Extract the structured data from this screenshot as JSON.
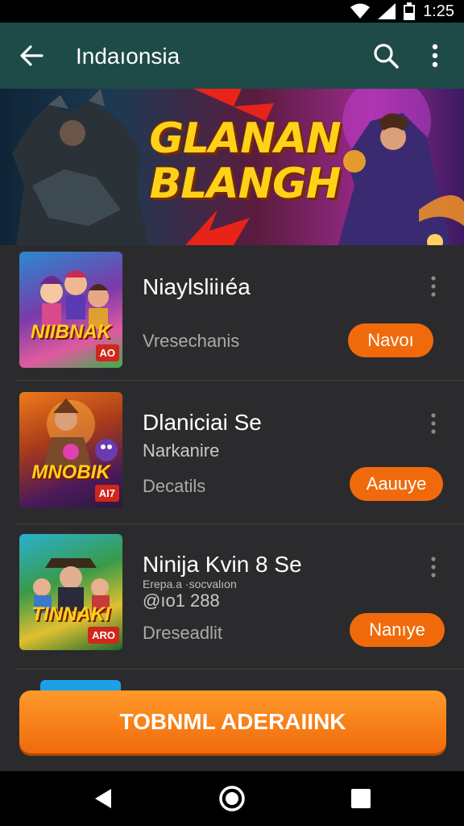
{
  "status_bar": {
    "time": "1:25"
  },
  "app_bar": {
    "title": "Indaıonsia",
    "back_icon": "arrow-left-icon",
    "search_icon": "search-icon",
    "more_icon": "more-vertical-icon"
  },
  "banner": {
    "title_line1": "GLANAN",
    "title_line2": "BLANGH"
  },
  "apps": [
    {
      "name": "Niaylsliiıéa",
      "subtitle": "",
      "subtitle2": "",
      "meta": "Vresechanis",
      "button": "Navoı",
      "thumb_logo": "NIIBNAK",
      "thumb_badge": "AO"
    },
    {
      "name": "Dlaniciai Se",
      "subtitle": "Narkanire",
      "subtitle2": "",
      "meta": "Decatils",
      "button": "Aauuye",
      "thumb_logo": "MNOBIK",
      "thumb_badge": "AI7"
    },
    {
      "name": "Ninija Kvin 8 Se",
      "subtitle": "@ıo1 288",
      "subtitle2": "Erepa.a ·socvalıon",
      "meta": "Dreseadlit",
      "button": "Nanıye",
      "thumb_logo": "TINNAKI",
      "thumb_badge": "ARO"
    }
  ],
  "cta": {
    "label": "TOBNML ADERAIINK"
  },
  "colors": {
    "app_bar": "#1e4a48",
    "accent": "#f06a0c",
    "background": "#2b2b2d",
    "banner_text": "#ffd21a"
  },
  "nav_bar": {
    "back_icon": "nav-back-icon",
    "home_icon": "nav-home-icon",
    "recents_icon": "nav-recents-icon"
  }
}
